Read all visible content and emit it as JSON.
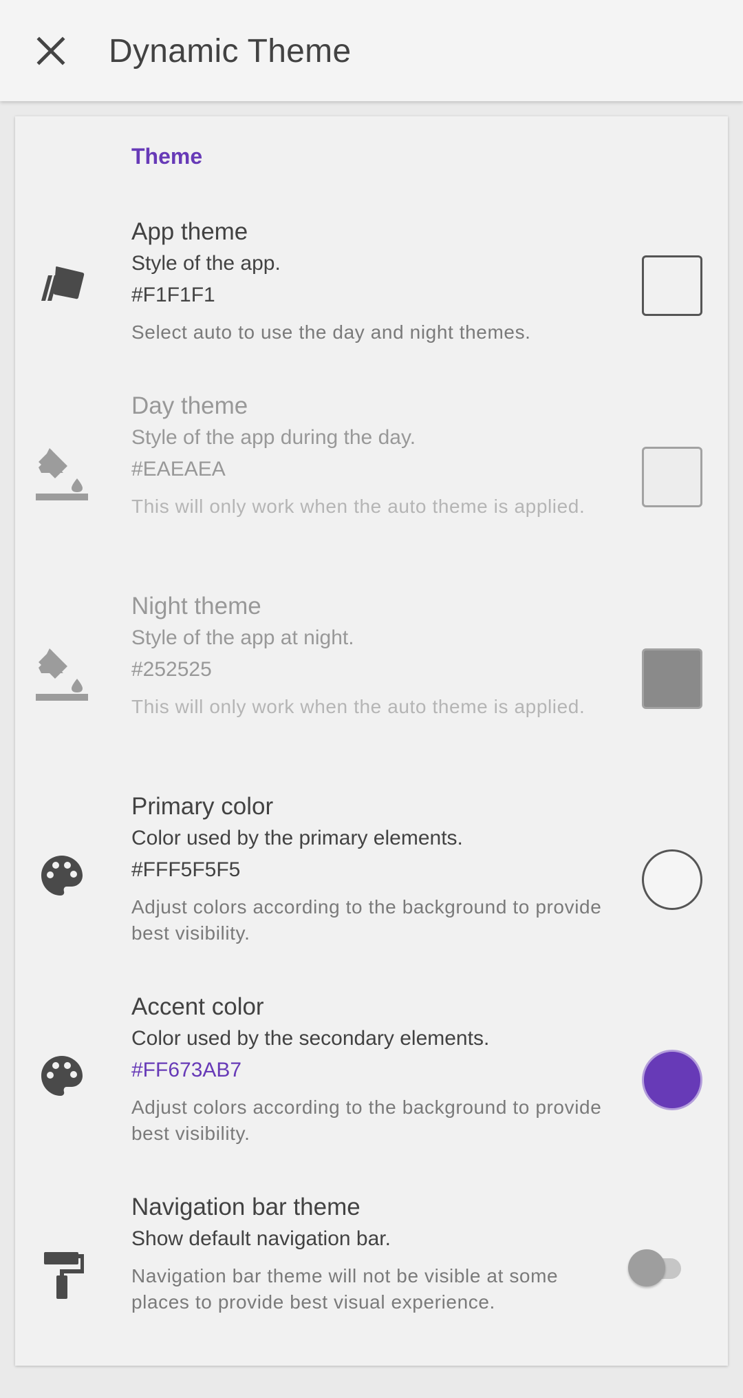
{
  "appbar": {
    "title": "Dynamic Theme",
    "close_icon": "close-icon"
  },
  "section": {
    "title": "Theme"
  },
  "rows": [
    {
      "title": "App theme",
      "subtitle": "Style of the app.",
      "value": "#F1F1F1",
      "note": "Select auto to use the day and night themes.",
      "icon": "cards-icon",
      "swatch_color": "#F1F1F1",
      "enabled": true
    },
    {
      "title": "Day theme",
      "subtitle": "Style of the app during the day.",
      "value": "#EAEAEA",
      "note": "This will only work when the auto theme is applied.",
      "icon": "paint-bucket-icon",
      "swatch_color": "#EAEAEA",
      "enabled": false
    },
    {
      "title": "Night theme",
      "subtitle": "Style of the app at night.",
      "value": "#252525",
      "note": "This will only work when the auto theme is applied.",
      "icon": "paint-bucket-icon",
      "swatch_color": "#252525",
      "enabled": false
    },
    {
      "title": "Primary color",
      "subtitle": "Color used by the primary elements.",
      "value": "#FFF5F5F5",
      "note": "Adjust colors according to the background to provide best visibility.",
      "icon": "palette-icon",
      "swatch_color": "#F5F5F5"
    },
    {
      "title": "Accent color",
      "subtitle": "Color used by the secondary elements.",
      "value": "#FF673AB7",
      "note": "Adjust colors according to the background to provide best visibility.",
      "icon": "palette-icon",
      "swatch_color": "#673AB7"
    },
    {
      "title": "Navigation bar theme",
      "subtitle": "Show default navigation bar.",
      "note": "Navigation bar theme will not be visible at some places to provide best visual experience.",
      "icon": "paint-roller-icon",
      "toggle_on": false
    }
  ],
  "colors": {
    "accent": "#673AB7",
    "card_background": "#F1F1F1",
    "screen_background": "#EAEAEA",
    "text_primary": "#424242"
  }
}
